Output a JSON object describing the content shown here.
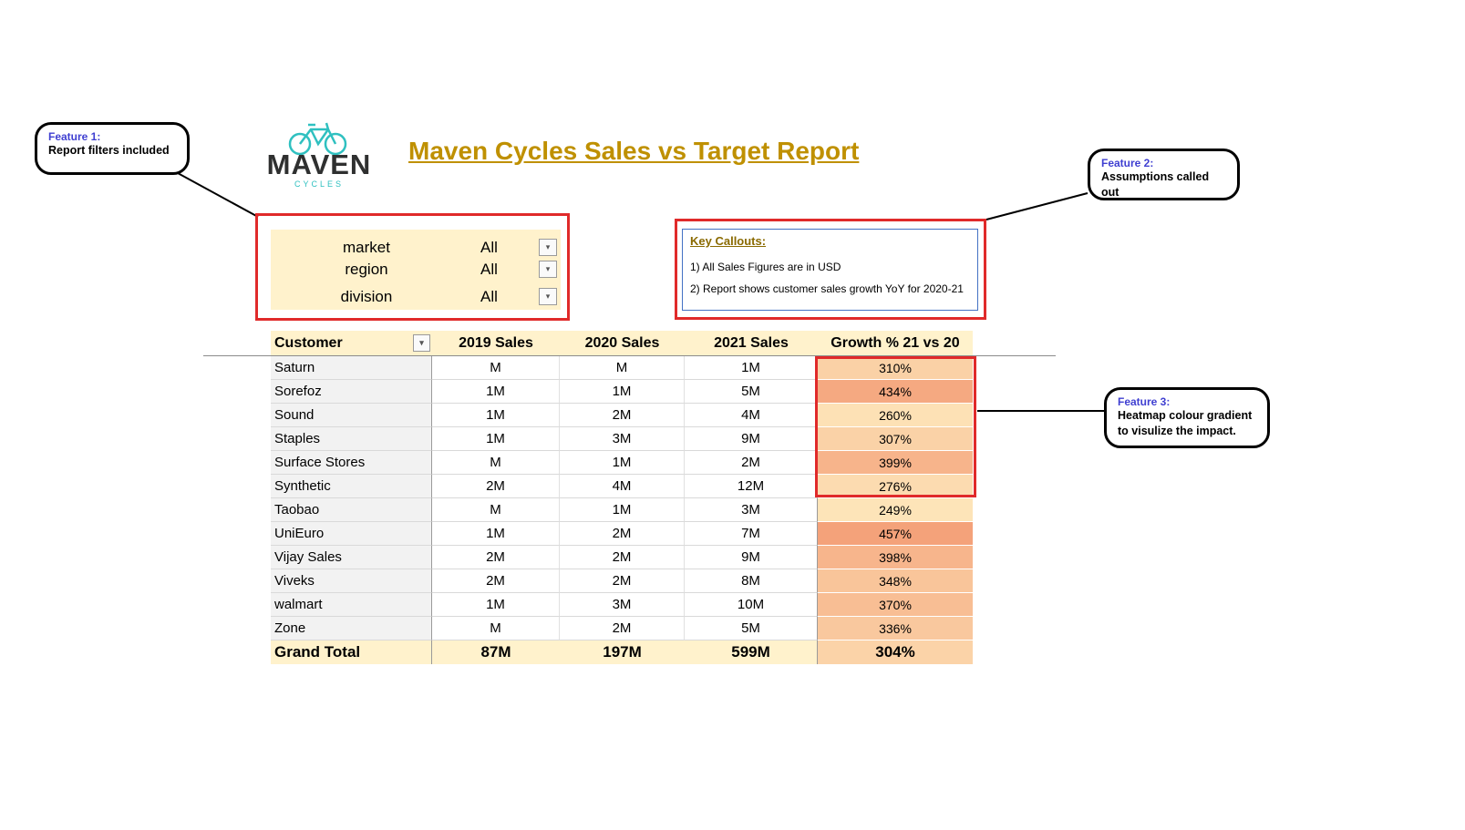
{
  "title": "Maven Cycles Sales vs Target Report",
  "logo": {
    "word": "MAVEN",
    "sub": "CYCLES"
  },
  "features": [
    {
      "title": "Feature 1:",
      "body": [
        "Report filters included"
      ]
    },
    {
      "title": "Feature 2:",
      "body": [
        "Assumptions called out"
      ]
    },
    {
      "title": "Feature 3:",
      "body": [
        "Heatmap colour gradient",
        "to visulize the impact."
      ]
    }
  ],
  "filters": [
    {
      "label": "market",
      "value": "All"
    },
    {
      "label": "region",
      "value": "All"
    },
    {
      "label": "division",
      "value": "All"
    }
  ],
  "key_callouts": {
    "heading": "Key Callouts:",
    "items": [
      "1) All Sales Figures are in USD",
      "2) Report shows customer sales growth YoY for 2020-21"
    ]
  },
  "table": {
    "headers": [
      "Customer",
      "2019 Sales",
      "2020 Sales",
      "2021 Sales",
      "Growth % 21 vs 20"
    ],
    "rows": [
      {
        "customer": "Saturn",
        "s2019": "M",
        "s2020": "M",
        "s2021": "1M",
        "growth": "310%",
        "growth_value": 310
      },
      {
        "customer": "Sorefoz",
        "s2019": "1M",
        "s2020": "1M",
        "s2021": "5M",
        "growth": "434%",
        "growth_value": 434
      },
      {
        "customer": "Sound",
        "s2019": "1M",
        "s2020": "2M",
        "s2021": "4M",
        "growth": "260%",
        "growth_value": 260
      },
      {
        "customer": "Staples",
        "s2019": "1M",
        "s2020": "3M",
        "s2021": "9M",
        "growth": "307%",
        "growth_value": 307
      },
      {
        "customer": "Surface Stores",
        "s2019": "M",
        "s2020": "1M",
        "s2021": "2M",
        "growth": "399%",
        "growth_value": 399
      },
      {
        "customer": "Synthetic",
        "s2019": "2M",
        "s2020": "4M",
        "s2021": "12M",
        "growth": "276%",
        "growth_value": 276
      },
      {
        "customer": "Taobao",
        "s2019": "M",
        "s2020": "1M",
        "s2021": "3M",
        "growth": "249%",
        "growth_value": 249
      },
      {
        "customer": "UniEuro",
        "s2019": "1M",
        "s2020": "2M",
        "s2021": "7M",
        "growth": "457%",
        "growth_value": 457
      },
      {
        "customer": "Vijay Sales",
        "s2019": "2M",
        "s2020": "2M",
        "s2021": "9M",
        "growth": "398%",
        "growth_value": 398
      },
      {
        "customer": "Viveks",
        "s2019": "2M",
        "s2020": "2M",
        "s2021": "8M",
        "growth": "348%",
        "growth_value": 348
      },
      {
        "customer": "walmart",
        "s2019": "1M",
        "s2020": "3M",
        "s2021": "10M",
        "growth": "370%",
        "growth_value": 370
      },
      {
        "customer": "Zone",
        "s2019": "M",
        "s2020": "2M",
        "s2021": "5M",
        "growth": "336%",
        "growth_value": 336
      }
    ],
    "total": {
      "label": "Grand Total",
      "s2019": "87M",
      "s2020": "197M",
      "s2021": "599M",
      "growth": "304%",
      "growth_value": 304
    }
  },
  "colors": {
    "title": "#bf9000",
    "header_bg": "#fff2cc",
    "heatmap_low": "#fde4b8",
    "heatmap_high": "#f4a27a",
    "highlight_border": "#e02a2a",
    "feature_title": "#3f3fd1",
    "logo_accent": "#2fc0c0"
  },
  "icons": {
    "filter_dropdown": "dropdown-arrow-icon",
    "logo": "bicycle-icon"
  }
}
